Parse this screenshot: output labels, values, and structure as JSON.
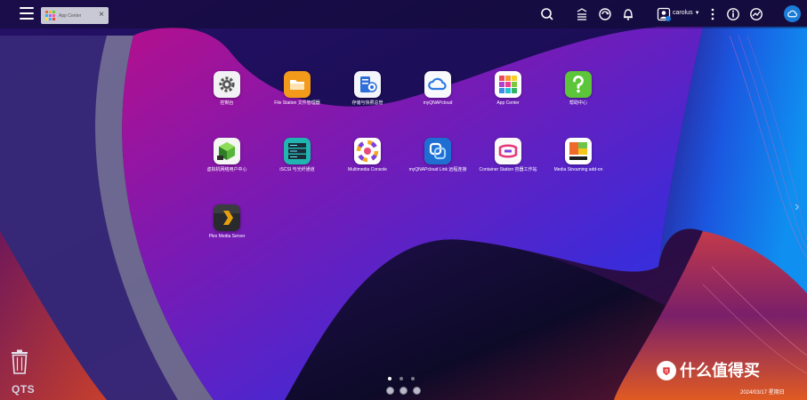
{
  "window": {
    "tab_label": "App Center",
    "close_glyph": "×"
  },
  "topbar": {
    "icons": [
      "search-icon",
      "stack-icon",
      "refresh-icon",
      "bell-icon"
    ],
    "user": {
      "name": "carolus",
      "badge": "0"
    },
    "more_icon": "more-icon",
    "info_icon": "info-icon",
    "dashboard_icon": "dashboard-icon",
    "cloud_icon": "cloud-icon"
  },
  "desktop": {
    "apps": [
      {
        "label": "控制台",
        "icon": "gear-icon"
      },
      {
        "label": "File Station 文件管理器",
        "icon": "folder-icon"
      },
      {
        "label": "存储与快照总管",
        "icon": "storage-icon"
      },
      {
        "label": "myQNAPcloud",
        "icon": "cloud-icon"
      },
      {
        "label": "App Center",
        "icon": "app-grid-icon"
      },
      {
        "label": "帮助中心",
        "icon": "help-icon"
      },
      {
        "label": "虚拟机网络用户中心",
        "icon": "cube-icon"
      },
      {
        "label": "iSCSI 与光纤通道",
        "icon": "server-icon"
      },
      {
        "label": "Multimedia Console",
        "icon": "multimedia-icon"
      },
      {
        "label": "myQNAPcloud Link 远程连接",
        "icon": "link-icon"
      },
      {
        "label": "Container Station 容器工作站",
        "icon": "container-icon"
      },
      {
        "label": "Media Streaming add-on",
        "icon": "media-icon"
      },
      {
        "label": "Plex Media Server",
        "icon": "plex-icon"
      }
    ]
  },
  "dock": {
    "label": "QTS",
    "trash_icon": "trash-icon"
  },
  "pagination": {
    "pages": 3,
    "current": 1
  },
  "watermark": {
    "text": "什么值得买"
  },
  "clock": {
    "date": "2024/03/17 星期日"
  },
  "colors": {
    "accent": "#1a7bd8",
    "topbar": "#080818"
  }
}
